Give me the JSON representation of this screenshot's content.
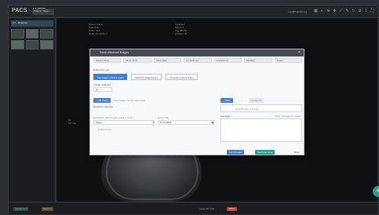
{
  "app": {
    "logo": "PACS · WEB",
    "patient_chip": "Patient · Study"
  },
  "toolbar": {
    "user": "user@hospital.org",
    "icons": [
      "layout-icon",
      "window-level-icon",
      "zoom-icon",
      "pan-icon",
      "measure-icon",
      "annotate-icon",
      "rotate-icon",
      "settings-icon",
      "share-icon",
      "fullscreen-icon"
    ]
  },
  "series_panel": {
    "study_header": "CT · Abdomen"
  },
  "viewport": {
    "overlay_tl": [
      "Patient Name",
      "Patient ID",
      "DOB / Sex",
      "Study Description"
    ],
    "overlay_tr": [
      "Institution",
      "Series 2",
      "Img 48/120",
      "W:400 L:40"
    ],
    "overlay_ml": [
      "Ax",
      "5.0 mm"
    ]
  },
  "modal": {
    "title": "Send reference images",
    "close": "×",
    "info": [
      "Patient Name",
      "01.01.1970",
      "Study Date",
      "CT Abdomen",
      "Accession #",
      "Modality",
      "Series"
    ],
    "section_type": "Reference type",
    "radios": [
      "Key images (current study)",
      "Selected images/series",
      "All series (current study)"
    ],
    "count_label": "Images selected",
    "count_value": "1",
    "left": {
      "add_button": "+ Add image",
      "add_hint": "Drag images into the area below",
      "section_recipient": "Recipient selection",
      "recipient_label": "Destination (PACS node / email / portal)",
      "recipient_value": "Select...",
      "date_label": "Expiry date",
      "date_value": "01.01.2025",
      "extra_hint": "Optional note"
    },
    "right": {
      "attach_button": "+ Attach",
      "disabled_button": "Upload file",
      "drop_hint": "Drop file here or browse",
      "comment_label": "Comment",
      "comment_hint": "Enter message for recipient"
    },
    "footer": {
      "primary": "Send images",
      "secondary": "Send and close",
      "cancel": "Close"
    }
  },
  "bottombar": {
    "item1": "Layout 1×1",
    "item2": "Series 2",
    "center": "Image 48 / 120",
    "status": "Offline"
  },
  "colors": {
    "accent": "#3e7fd3",
    "teal": "#1fa58a",
    "status_red": "#c23a3a"
  }
}
